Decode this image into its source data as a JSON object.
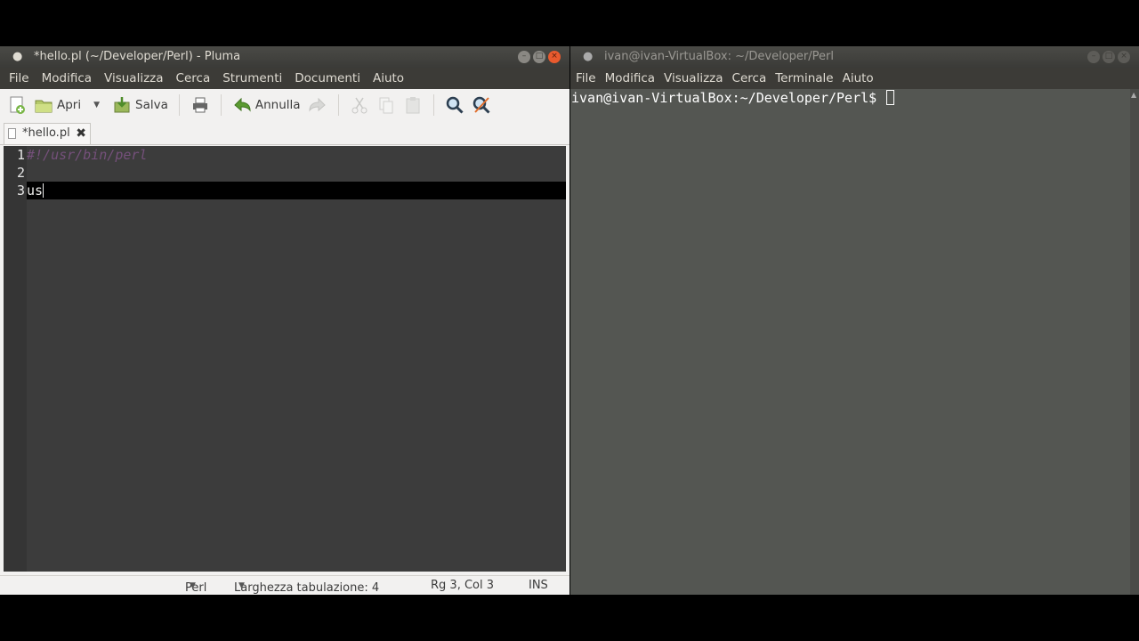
{
  "editor": {
    "window_title": "*hello.pl (~/Developer/Perl) - Pluma",
    "menu": [
      "File",
      "Modifica",
      "Visualizza",
      "Cerca",
      "Strumenti",
      "Documenti",
      "Aiuto"
    ],
    "toolbar": {
      "open_label": "Apri",
      "save_label": "Salva",
      "undo_label": "Annulla"
    },
    "tab": {
      "name": "*hello.pl"
    },
    "line_numbers": [
      "1",
      "2",
      "3"
    ],
    "lines": [
      "#!/usr/bin/perl",
      "",
      "us"
    ],
    "status": {
      "language": "Perl",
      "tab_width": "Larghezza tabulazione:  4",
      "position": "Rg 3, Col 3",
      "mode": "INS"
    }
  },
  "terminal": {
    "window_title": "ivan@ivan-VirtualBox: ~/Developer/Perl",
    "menu": [
      "File",
      "Modifica",
      "Visualizza",
      "Cerca",
      "Terminale",
      "Aiuto"
    ],
    "prompt": "ivan@ivan-VirtualBox:~/Developer/Perl$ "
  },
  "colors": {
    "title_bg": "#3c3b37",
    "editor_bg": "#3c3c3c",
    "terminal_bg": "#545652",
    "comment": "#75507b",
    "close_button": "#e95a2e"
  }
}
